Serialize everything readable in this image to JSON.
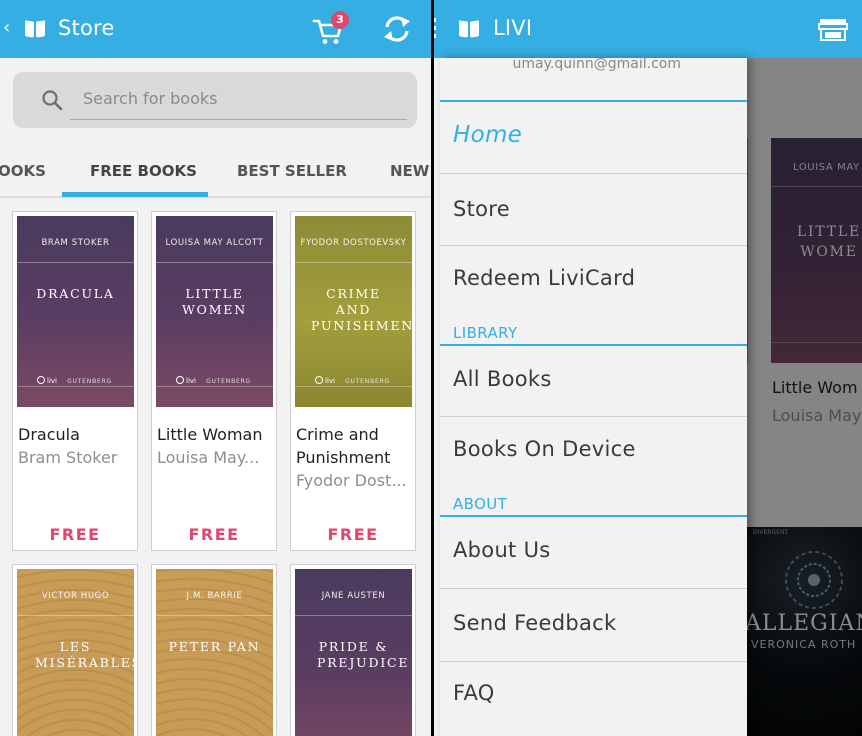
{
  "left": {
    "appbar": {
      "title": "Store",
      "cart_count": "3"
    },
    "search": {
      "placeholder": "Search for books"
    },
    "tabs": [
      "OOKS",
      "FREE BOOKS",
      "BEST SELLER",
      "NEW R"
    ],
    "books": [
      {
        "cover_author": "BRAM STOKER",
        "cover_title": "DRACULA",
        "name1": "Dracula",
        "name2": "",
        "author": "Bram Stoker",
        "price": "FREE",
        "cover_style": "purple"
      },
      {
        "cover_author": "LOUISA MAY ALCOTT",
        "cover_title": "LITTLE WOMEN",
        "name1": "Little Woman",
        "name2": "",
        "author": "Louisa May...",
        "price": "FREE",
        "cover_style": "purple"
      },
      {
        "cover_author": "FYODOR DOSTOEVSKY",
        "cover_title": "CRIME AND PUNISHMENT",
        "name1": "Crime and",
        "name2": "Punishment",
        "author": "Fyodor Dost...",
        "price": "FREE",
        "cover_style": "olive"
      },
      {
        "cover_author": "VICTOR HUGO",
        "cover_title": "LES MISÉRABLES",
        "cover_style": "tan"
      },
      {
        "cover_author": "J.M. BARRIE",
        "cover_title": "PETER PAN",
        "cover_style": "tan2"
      },
      {
        "cover_author": "JANE AUSTEN",
        "cover_title": "PRIDE & PREJUDICE",
        "cover_style": "purple"
      }
    ],
    "cover_publisher": "GUTENBERG",
    "cover_logo": "livi"
  },
  "right": {
    "appbar": {
      "title": "LIVI"
    },
    "drawer": {
      "email": "umay.quinn@gmail.com",
      "home": "Home",
      "store": "Store",
      "redeem": "Redeem LiviCard",
      "library_header": "LIBRARY",
      "all_books": "All Books",
      "books_on_device": "Books On Device",
      "about_header": "ABOUT",
      "about_us": "About Us",
      "send_feedback": "Send Feedback",
      "faq": "FAQ"
    },
    "behind": {
      "cover_author": "LOUISA MAY A",
      "cover_title": "LITTLE WOME",
      "name": "Little Wom",
      "author": "Louisa May",
      "allegiant_title": "ALLEGIANT",
      "allegiant_author": "VERONICA ROTH",
      "allegiant_top": "DIVERGENT"
    }
  },
  "colors": {
    "accent": "#35aee3",
    "price": "#e0476b"
  }
}
